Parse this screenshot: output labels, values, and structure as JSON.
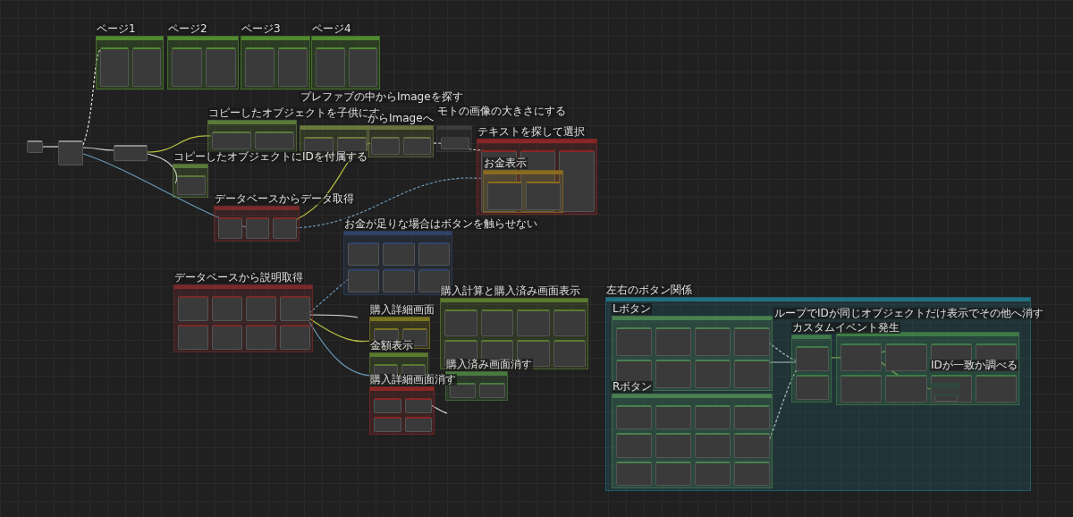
{
  "canvas": {
    "groups": [
      {
        "title": "ページ1",
        "color": "#4f8a2e"
      },
      {
        "title": "ページ2",
        "color": "#4f8a2e"
      },
      {
        "title": "ページ3",
        "color": "#4f8a2e"
      },
      {
        "title": "ページ4",
        "color": "#4f8a2e"
      },
      {
        "title": "コピーしたオブジェクトを子供にす",
        "color": "#5a7a3a"
      },
      {
        "title": "プレファブの中からImageを探す",
        "color": "#6a7a3a"
      },
      {
        "title": "からImageへ",
        "color": "#6a7040"
      },
      {
        "title": "モトの画像の大きさにする",
        "color": "#3c3c3c"
      },
      {
        "title": "コピーしたオブジェクトにIDを付属する",
        "color": "#5a7a3a"
      },
      {
        "title": "データベースからデータ取得",
        "color": "#7a2a2a"
      },
      {
        "title": "テキストを探して選択",
        "color": "#8a2626"
      },
      {
        "title": "お金表示",
        "color": "#8a6a1e"
      },
      {
        "title": "お金が足りな場合はボタンを触らせない",
        "color": "#2e4466"
      },
      {
        "title": "データベースから説明取得",
        "color": "#7a2a2a"
      },
      {
        "title": "購入詳細画面",
        "color": "#7a7420"
      },
      {
        "title": "購入計算と購入済み画面表示",
        "color": "#5a7a30"
      },
      {
        "title": "金額表示",
        "color": "#5a7a30"
      },
      {
        "title": "購入済み画面消す",
        "color": "#4a7a40"
      },
      {
        "title": "購入詳細画面消す",
        "color": "#8a2626"
      },
      {
        "title": "左右のボタン関係",
        "color": "#1f7080"
      },
      {
        "title": "Lボタン",
        "color": "#4a8050"
      },
      {
        "title": "Rボタン",
        "color": "#4a8050"
      },
      {
        "title": "ループでIDが同じオブジェクトだけ表示でその他へ消す",
        "color": "#3f7a48"
      },
      {
        "title": "カスタムイベント発生",
        "color": "#3f7a48"
      },
      {
        "title": "IDが一致か調べる",
        "color": "#2e4a40"
      }
    ]
  }
}
